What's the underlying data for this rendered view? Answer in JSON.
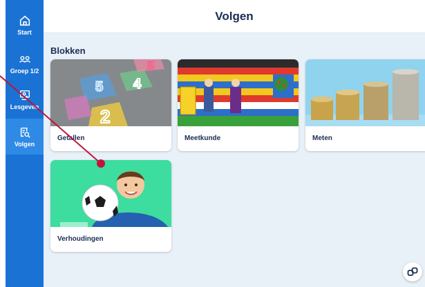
{
  "sidebar": {
    "items": [
      {
        "label": "Start",
        "icon": "home-icon",
        "active": false
      },
      {
        "label": "Groep 1/2",
        "icon": "group-icon",
        "active": false
      },
      {
        "label": "Lesgeven",
        "icon": "teach-icon",
        "active": false
      },
      {
        "label": "Volgen",
        "icon": "follow-icon",
        "active": true
      }
    ]
  },
  "header": {
    "title": "Volgen"
  },
  "main": {
    "section_title": "Blokken",
    "cards": [
      {
        "label": "Getallen"
      },
      {
        "label": "Meetkunde"
      },
      {
        "label": "Meten"
      },
      {
        "label": "Verhoudingen"
      }
    ]
  },
  "fab": {
    "icon": "link-icon"
  },
  "colors": {
    "sidebar": "#1a73d4",
    "sidebar_active": "#2f8ae6",
    "background": "#e8f0f8",
    "title": "#1b2d52",
    "annotation": "#c0143c"
  }
}
